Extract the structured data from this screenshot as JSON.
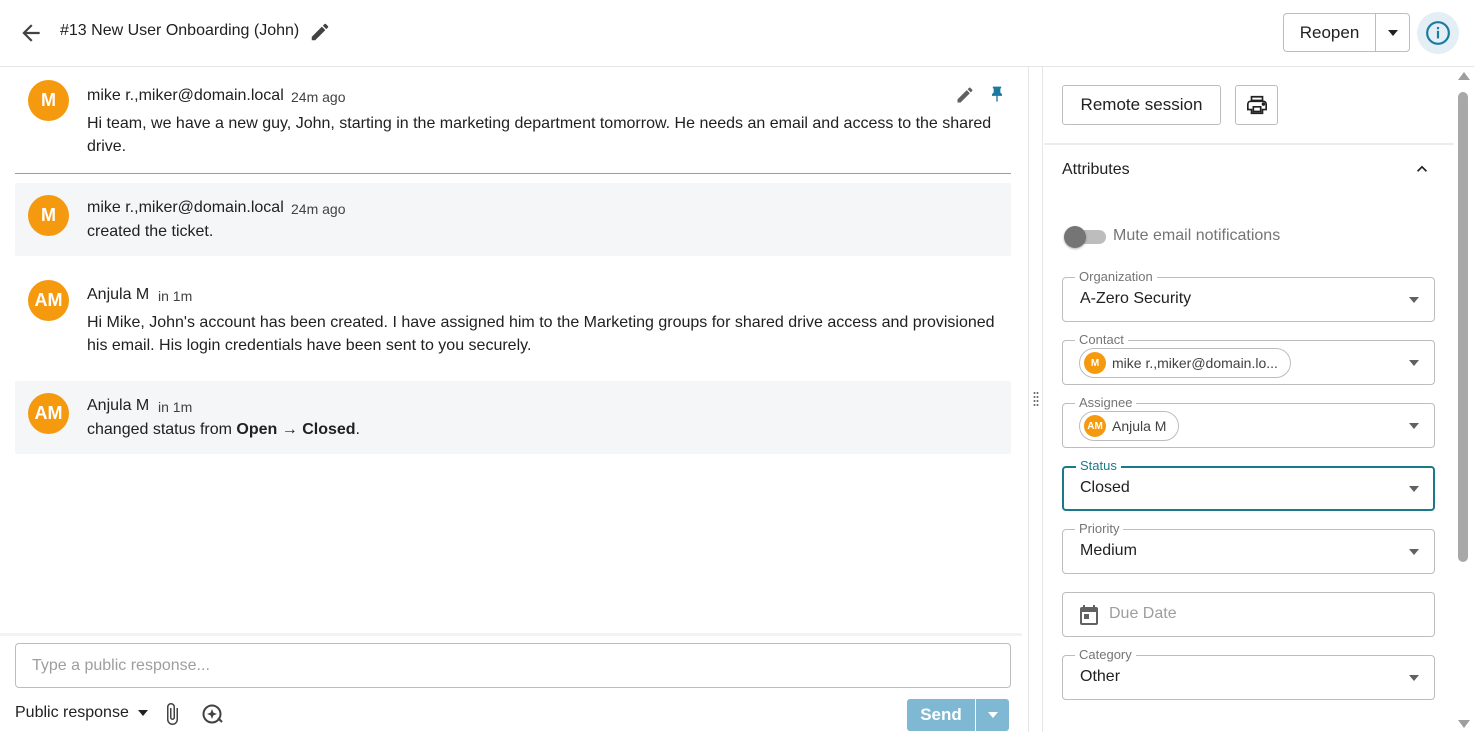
{
  "header": {
    "title": "#13 New User Onboarding (John)",
    "reopen_label": "Reopen"
  },
  "messages": [
    {
      "avatar": "M",
      "author": "mike r.,miker@domain.local",
      "time": "24m ago",
      "line1": "Hi team, we have a new guy, John, starting in the marketing department tomorrow. He needs an email and access to the shared",
      "line2": "drive."
    },
    {
      "avatar": "M",
      "author": "mike r.,miker@domain.local",
      "time": "24m ago",
      "text": "created the ticket."
    },
    {
      "avatar": "AM",
      "author": "Anjula M",
      "time": "in 1m",
      "line1": "Hi Mike, John's account has been created. I have assigned him to the Marketing groups for shared drive access and provisioned",
      "line2": "his email. His login credentials have been sent to you securely."
    },
    {
      "avatar": "AM",
      "author": "Anjula M",
      "time": "in 1m",
      "prefix": "changed status from ",
      "from": "Open",
      "arrow": " → ",
      "to": "Closed",
      "suffix": "."
    }
  ],
  "composer": {
    "placeholder": "Type a public response...",
    "response_type": "Public response",
    "send_label": "Send"
  },
  "panel": {
    "remote_label": "Remote session",
    "attributes_title": "Attributes",
    "mute_label": "Mute email notifications",
    "mute_on": false,
    "fields": {
      "organization": {
        "label": "Organization",
        "value": "A-Zero Security"
      },
      "contact": {
        "label": "Contact",
        "avatar": "M",
        "value": "mike r.,miker@domain.lo..."
      },
      "assignee": {
        "label": "Assignee",
        "avatar": "AM",
        "value": "Anjula M"
      },
      "status": {
        "label": "Status",
        "value": "Closed"
      },
      "priority": {
        "label": "Priority",
        "value": "Medium"
      },
      "due_date": {
        "placeholder": "Due Date"
      },
      "category": {
        "label": "Category",
        "value": "Other"
      }
    }
  },
  "colors": {
    "avatar": "#f59a0f",
    "accent": "#1a7a8a",
    "pin": "#1a7aa0",
    "send": "#7fb8d2"
  },
  "icons": [
    "arrow-left-icon",
    "pencil-icon",
    "chevron-down-icon",
    "info-icon",
    "pin-icon",
    "paperclip-icon",
    "ai-sparkle-icon",
    "printer-icon",
    "chevron-up-icon",
    "calendar-icon"
  ]
}
